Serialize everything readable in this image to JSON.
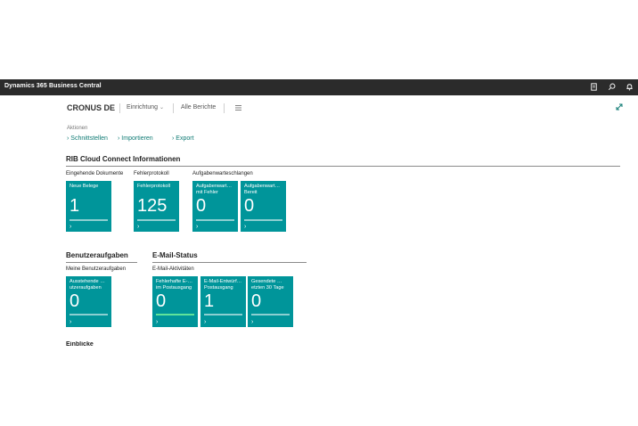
{
  "app": {
    "title": "Dynamics 365 Business Central"
  },
  "topbar_icons": [
    "document-icon",
    "search-icon",
    "bell-icon"
  ],
  "nav": {
    "company": "CRONUS DE",
    "setup": "Einrichtung",
    "reports": "Alle Berichte",
    "menu_icon": "hamburger-icon"
  },
  "actions": {
    "label": "Aktionen",
    "items": [
      "Schnittstellen",
      "Importieren",
      "Export"
    ]
  },
  "rib": {
    "title": "RIB Cloud Connect Informationen",
    "groups": [
      {
        "label": "Eingehende Dokumente",
        "tiles": [
          {
            "title": "Neue Belege",
            "value": "1"
          }
        ]
      },
      {
        "label": "Fehlerprotokoll",
        "tiles": [
          {
            "title": "Fehlerprotokoll",
            "value": "125"
          }
        ]
      },
      {
        "label": "Aufgabenwarteschlangen",
        "tiles": [
          {
            "title": "Aufgabenwart… mit Fehler",
            "value": "0"
          },
          {
            "title": "Aufgabenwart… Bereit",
            "value": "0"
          }
        ]
      }
    ]
  },
  "user_tasks": {
    "title": "Benutzeraufgaben",
    "group_label": "Meine Benutzeraufgaben",
    "tiles": [
      {
        "title": "Ausstehende …utzeraufgaben",
        "value": "0"
      }
    ]
  },
  "email": {
    "title": "E-Mail-Status",
    "group_label": "E-Mail-Aktivitäten",
    "tiles": [
      {
        "title": "Fehlerhafte E-… im Postausgang",
        "value": "0"
      },
      {
        "title": "E-Mail-Entwürf… Postausgang",
        "value": "1"
      },
      {
        "title": "Gesendete …etzten 30 Tage",
        "value": "0"
      }
    ]
  },
  "insights": {
    "title": "Einblicke"
  },
  "colors": {
    "tile": "#00959a",
    "topbar": "#2b2b2b",
    "accent": "#0f7b74",
    "bar_highlight": "#5fe39a"
  }
}
